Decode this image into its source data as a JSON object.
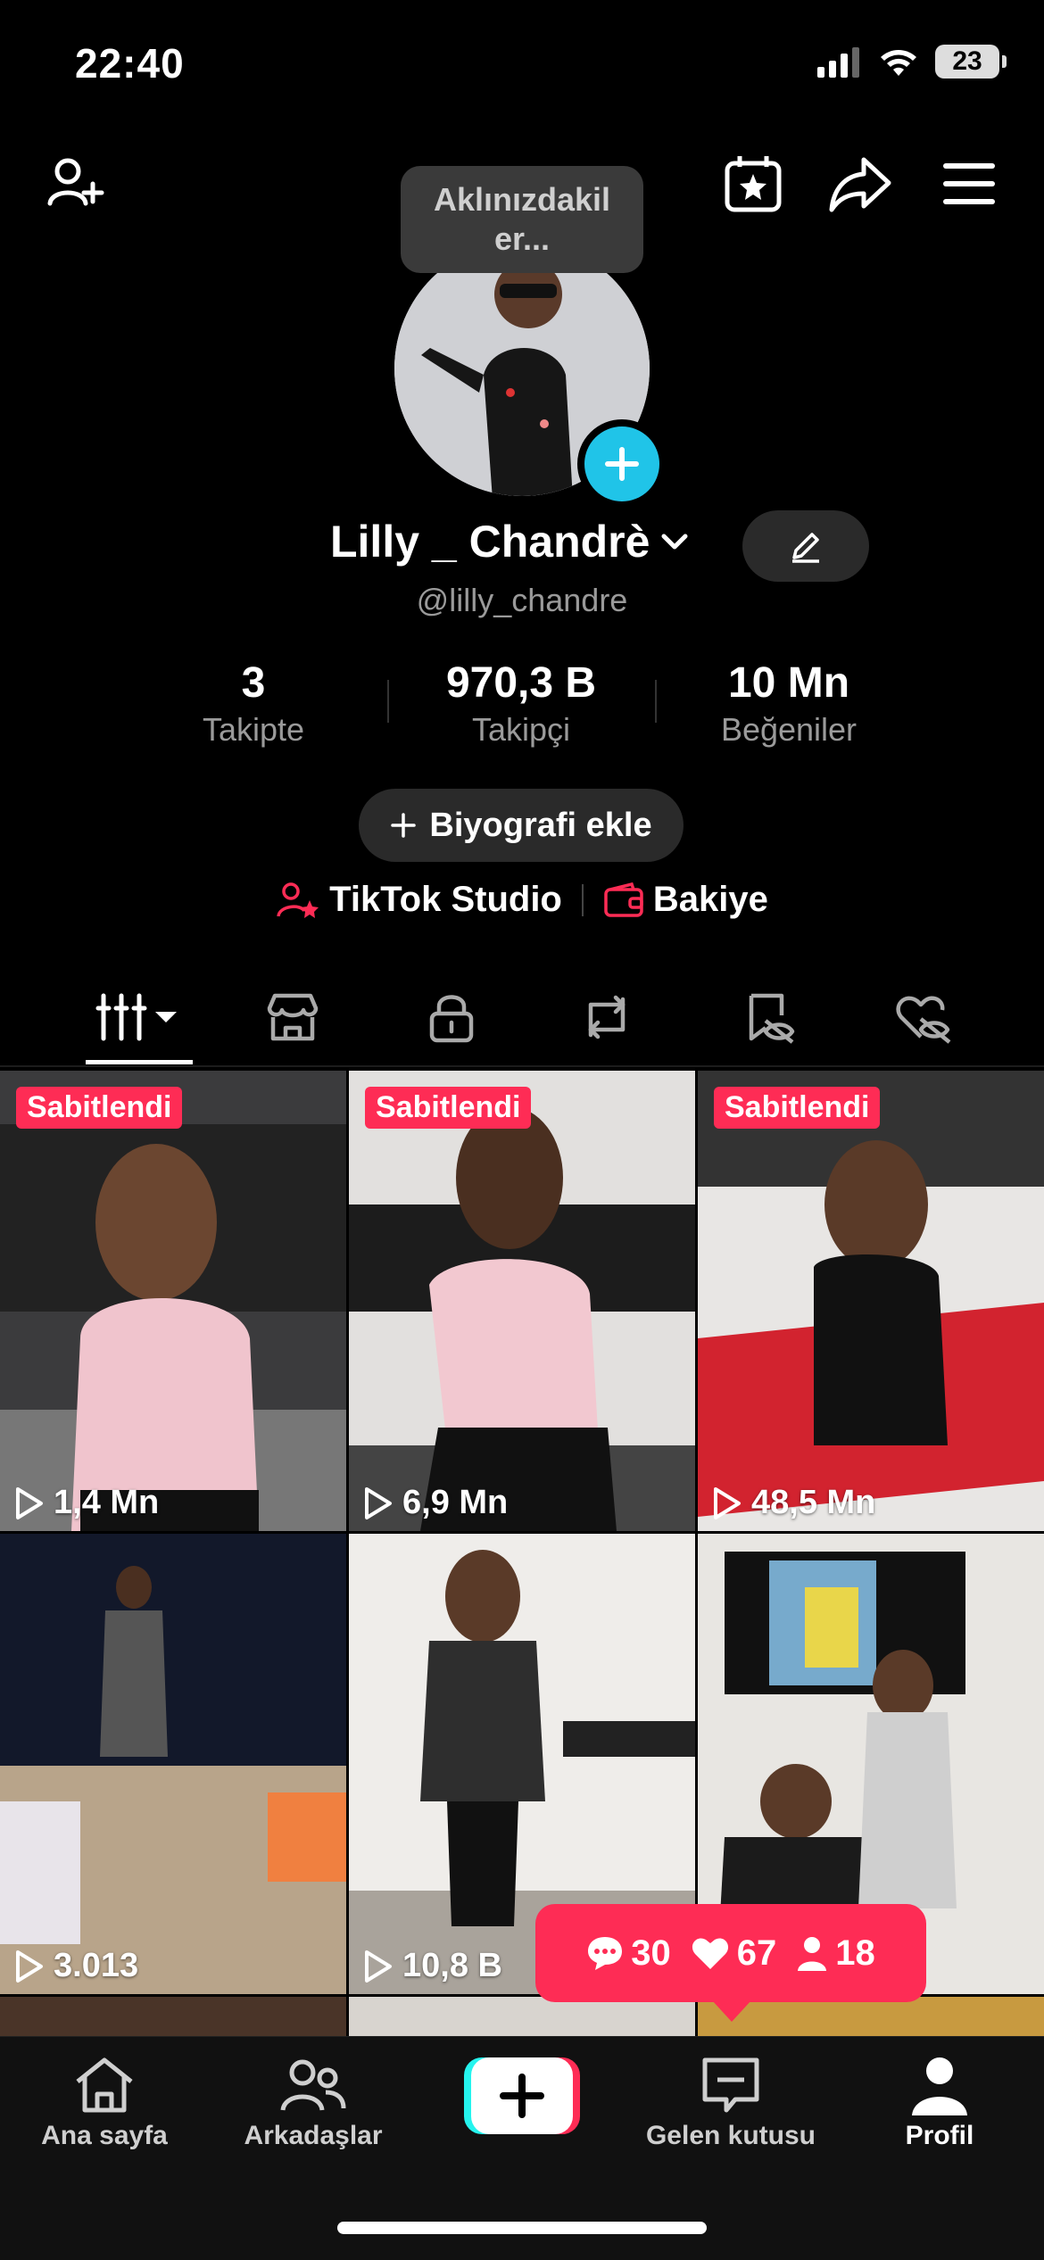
{
  "status_bar": {
    "time": "22:40",
    "battery": "23"
  },
  "tooltip": {
    "text": "Aklınızdakil\ner..."
  },
  "profile": {
    "name": "Lilly _ Chandrè",
    "handle": "@lilly_chandre",
    "stats": [
      {
        "value": "3",
        "label": "Takipte"
      },
      {
        "value": "970,3 B",
        "label": "Takipçi"
      },
      {
        "value": "10 Mn",
        "label": "Beğeniler"
      }
    ],
    "bio_button": "Biyografi ekle",
    "links": {
      "studio": "TikTok Studio",
      "balance": "Bakiye"
    }
  },
  "videos": [
    {
      "pinned_label": "Sabitlendi",
      "views": "1,4 Mn"
    },
    {
      "pinned_label": "Sabitlendi",
      "views": "6,9 Mn"
    },
    {
      "pinned_label": "Sabitlendi",
      "views": "48,5 Mn"
    },
    {
      "pinned_label": "",
      "views": "3.013"
    },
    {
      "pinned_label": "",
      "views": "10,8 B"
    },
    {
      "pinned_label": "",
      "views": ""
    }
  ],
  "notifications": {
    "comments": "30",
    "likes": "67",
    "followers": "18"
  },
  "nav": {
    "home": "Ana sayfa",
    "friends": "Arkadaşlar",
    "inbox": "Gelen kutusu",
    "profile": "Profil"
  },
  "colors": {
    "accent": "#fe2c55",
    "cyan": "#20c4e8"
  }
}
